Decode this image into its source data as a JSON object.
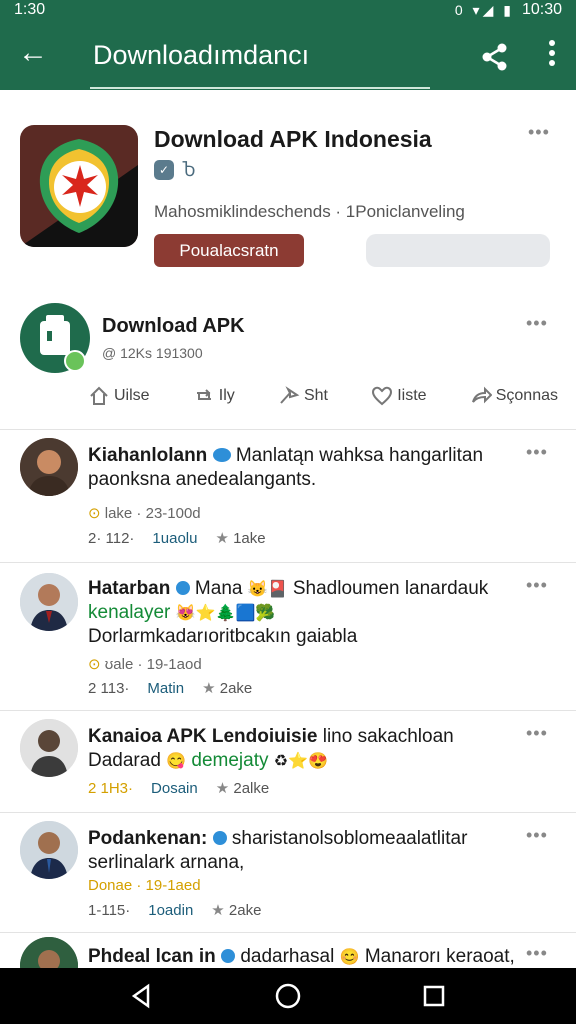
{
  "status": {
    "time": "1:30",
    "right_time": "10:30",
    "icons": "0 ▾◢ ▮"
  },
  "appbar": {
    "back_label": "←",
    "title": "Downloadımdancı"
  },
  "app": {
    "title": "Download APK Indonesia",
    "meta": "Mahosmiklindeschends · 1Poniclanveling",
    "install_label": "Poualacsratn",
    "badge2": "Ⴆ",
    "icon_name": "shield-star-icon"
  },
  "profile": {
    "name": "Download APK",
    "handle": "@ 12Ks 191300",
    "actions": [
      {
        "label": "Uilse",
        "icon": "home-icon"
      },
      {
        "label": "Ily",
        "icon": "repost-icon"
      },
      {
        "label": "Sht",
        "icon": "share-arrow-icon"
      },
      {
        "label": "Iiste",
        "icon": "heart-icon"
      },
      {
        "label": "Sçonnas",
        "icon": "forward-icon"
      }
    ]
  },
  "posts": [
    {
      "author": "Kiahanlolann",
      "text_rest": "Manlatąn wahksa hangarlitan paonksna anedealangants.",
      "meta": "lake · 23-100d",
      "stats_count": "2· 112·",
      "stats_link": "1uaolu",
      "stats_star": "1ake"
    },
    {
      "author": "Hatarban",
      "text_mid": "Mana",
      "text_rest": "Shadloumen lanardauk",
      "green_line": "kenalayer",
      "text_line2": "Dorlarmkadarıoritbcakın gaiabla",
      "meta": "ʊale · 19-1aod",
      "stats_count": "2 113·",
      "stats_link": "Matin",
      "stats_star": "2ake"
    },
    {
      "author": "Kanaioa APK Lendoiuisie",
      "text_rest": "lino sakachloan",
      "text_line2": "Dadarad",
      "green_line": "demejaty",
      "meta": "",
      "stats_count": "2 1H3·",
      "stats_link": "Dosain",
      "stats_star": "2alke"
    },
    {
      "author": "Podankenan:",
      "text_rest": "sharistanolsoblomeaalatlitar serlinalark arnana,",
      "meta": "Donae · 19-1aed",
      "stats_count": "1-115·",
      "stats_link": "1oadin",
      "stats_star": "2ake"
    },
    {
      "author": "Phdeal lcan in",
      "text_rest": "dadarhasal",
      "text_tail": "Manarorı keraoat,"
    }
  ],
  "colors": {
    "brand": "#1f6b4c",
    "install": "#8c3b33",
    "link": "#1c5d7a"
  }
}
